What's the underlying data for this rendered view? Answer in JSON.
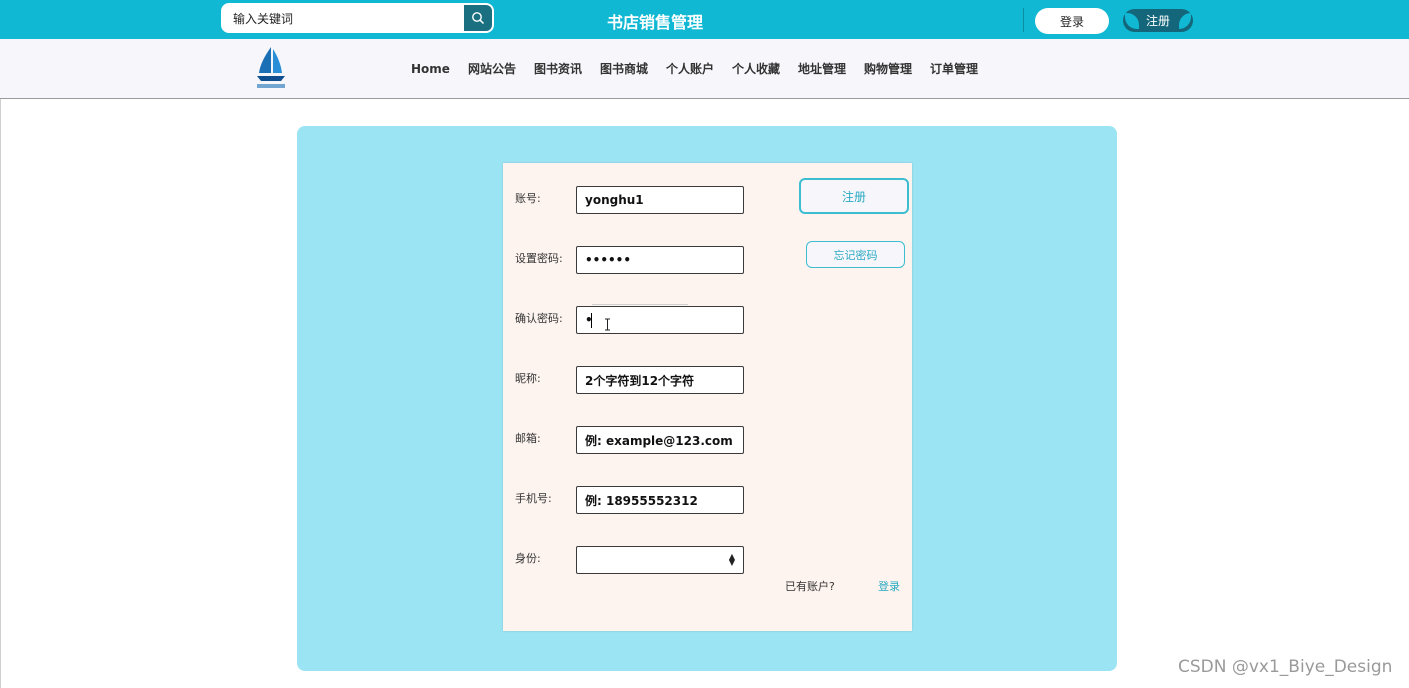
{
  "header": {
    "search_placeholder": "输入关键词",
    "title": "书店销售管理",
    "login_label": "登录",
    "register_label": "注册"
  },
  "nav": {
    "items": [
      "Home",
      "网站公告",
      "图书资讯",
      "图书商城",
      "个人账户",
      "个人收藏",
      "地址管理",
      "购物管理",
      "订单管理"
    ]
  },
  "form": {
    "account_label": "账号:",
    "account_value": "yonghu1",
    "password_label": "设置密码:",
    "password_value": "••••••",
    "confirm_label": "确认密码:",
    "confirm_value": "•",
    "nickname_label": "昵称:",
    "nickname_value": "2个字符到12个字符",
    "email_label": "邮箱:",
    "email_value": "例: example@123.com",
    "phone_label": "手机号:",
    "phone_value": "例: 18955552312",
    "role_label": "身份:",
    "role_value": ""
  },
  "side": {
    "register_label": "注册",
    "forgot_label": "忘记密码"
  },
  "footer": {
    "has_account": "已有账户?",
    "login_link": "登录"
  },
  "watermark": "CSDN @vx1_Biye_Design",
  "colors": {
    "topbar": "#10b8d3",
    "panel": "#9be4f3",
    "card": "#fdf4f0",
    "accent": "#2aa9c2"
  }
}
